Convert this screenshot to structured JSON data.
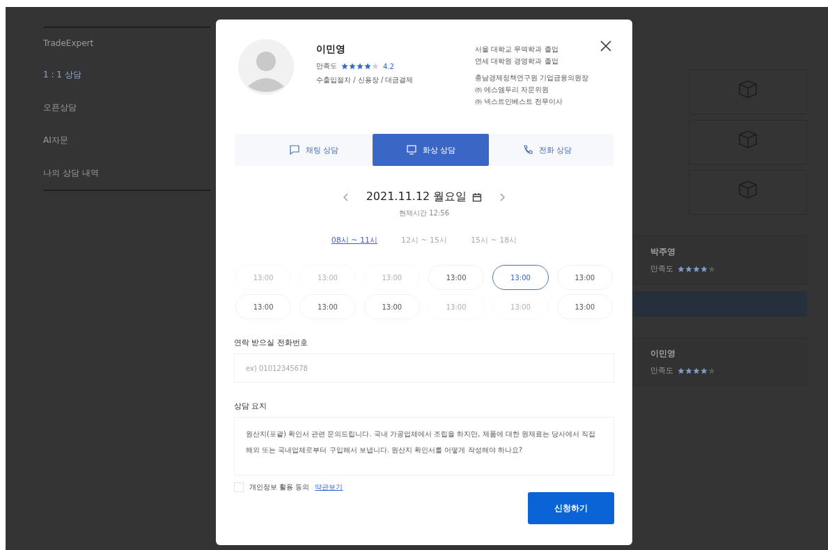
{
  "sidebar": {
    "items": [
      {
        "label": "TradeExpert",
        "selected": false
      },
      {
        "label": "1 : 1 상담",
        "selected": true
      },
      {
        "label": "오픈상담",
        "selected": false
      },
      {
        "label": "AI자문",
        "selected": false
      },
      {
        "label": "나의 상담 내역",
        "selected": false
      }
    ]
  },
  "background_cards": [
    {
      "name": "박주영",
      "rating_label": "만족도",
      "stars": 4
    },
    {
      "name": "이민영",
      "rating_label": "만족도",
      "stars": 4
    }
  ],
  "modal": {
    "expert": {
      "name": "이민영",
      "rating_label": "만족도",
      "stars": 4,
      "rating": "4.2",
      "fields": "수출입절차 / 신용장 / 대금결제",
      "career": [
        [
          "서울 대학교 무역학과 졸업",
          "연세 대학원 경영학과 졸업"
        ],
        [
          "충남경제정책연구원 기업금융의원장",
          "㈜ 에스엠두리 자문위원",
          "㈜ 넥스트인베스트 전무이사"
        ]
      ]
    },
    "tabs": [
      {
        "label": "채팅 상담",
        "kind": "chat",
        "selected": false
      },
      {
        "label": "화상 상담",
        "kind": "video",
        "selected": true
      },
      {
        "label": "전화 상담",
        "kind": "phone",
        "selected": false
      }
    ],
    "date": "2021.11.12 월요일",
    "current_time": "현재시간 12:56",
    "ranges": [
      {
        "label": "08시 ~ 11시",
        "selected": true
      },
      {
        "label": "12시 ~ 15시",
        "selected": false
      },
      {
        "label": "15시 ~ 18시",
        "selected": false
      }
    ],
    "slots": [
      {
        "time": "13:00",
        "disabled": true,
        "selected": false
      },
      {
        "time": "13:00",
        "disabled": true,
        "selected": false
      },
      {
        "time": "13:00",
        "disabled": true,
        "selected": false
      },
      {
        "time": "13:00",
        "disabled": false,
        "selected": false
      },
      {
        "time": "13:00",
        "disabled": false,
        "selected": true
      },
      {
        "time": "13:00",
        "disabled": false,
        "selected": false
      },
      {
        "time": "13:00",
        "disabled": false,
        "selected": false
      },
      {
        "time": "13:00",
        "disabled": false,
        "selected": false
      },
      {
        "time": "13:00",
        "disabled": false,
        "selected": false
      },
      {
        "time": "13:00",
        "disabled": true,
        "selected": false
      },
      {
        "time": "13:00",
        "disabled": true,
        "selected": false
      },
      {
        "time": "13:00",
        "disabled": false,
        "selected": false
      }
    ],
    "phone_label": "연락 받으실 전화번호",
    "phone": {
      "placeholder": "ex) 01012345678"
    },
    "summary_label": "상담 요지",
    "summary": "원산지(포괄) 확인서 관련 문의드립니다. 국내 가공업체에서 조립을 하지만, 제품에 대한 원재료는 당사에서 직접 해외 또는 국내업체로부터 구입해서 보냅니다. 원산지 확인서를 어떻게 작성해야 하나요?",
    "consent": {
      "label": "개인정보 활용 동의",
      "link": "약관보기",
      "checked": false
    },
    "submit": "신청하기"
  }
}
